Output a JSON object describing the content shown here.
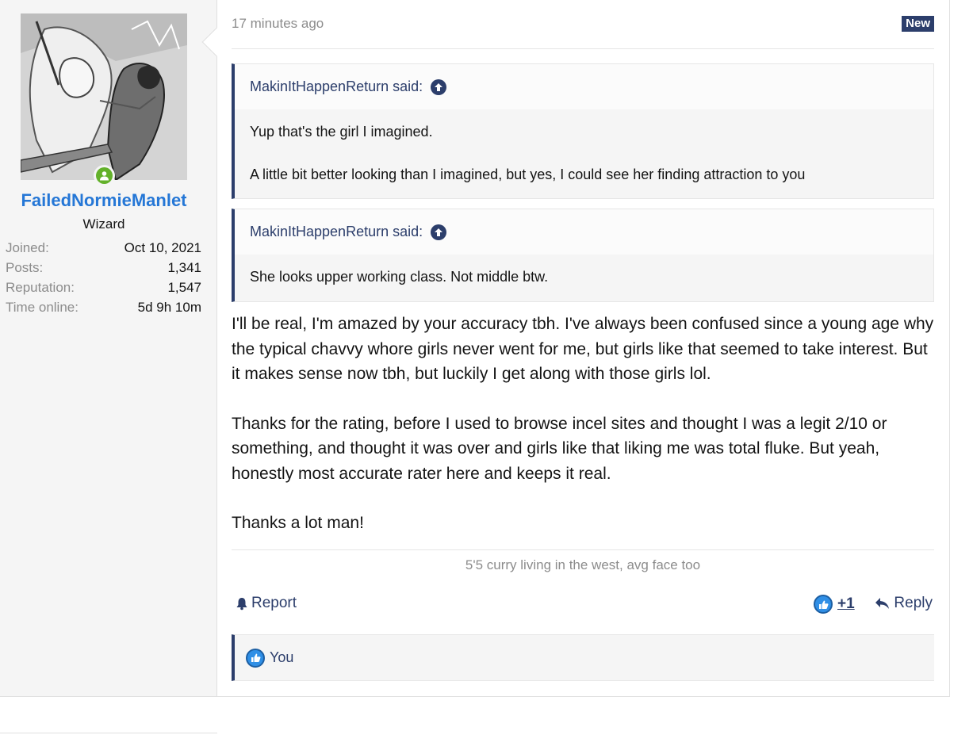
{
  "user": {
    "name": "FailedNormieManlet",
    "title": "Wizard",
    "stats": [
      {
        "label": "Joined:",
        "value": "Oct 10, 2021"
      },
      {
        "label": "Posts:",
        "value": "1,341"
      },
      {
        "label": "Reputation:",
        "value": "1,547"
      },
      {
        "label": "Time online:",
        "value": "5d 9h 10m"
      }
    ],
    "status_color": "#63b12a"
  },
  "post": {
    "time": "17 minutes ago",
    "badge": "New",
    "quotes": [
      {
        "author": "MakinItHappenReturn said:",
        "lines": [
          "Yup that's the girl I imagined.",
          "A little bit better looking than I imagined, but yes, I could see her finding attraction to you"
        ]
      },
      {
        "author": "MakinItHappenReturn said:",
        "lines": [
          "She looks upper working class. Not middle btw."
        ]
      }
    ],
    "paragraphs": [
      "I'll be real, I'm amazed by your accuracy tbh. I've always been confused since a young age why the typical chavvy whore girls never went for me, but girls like that seemed to take interest. But it makes sense now tbh, but luckily I get along with those girls lol.",
      "Thanks for the rating, before I used to browse incel sites and thought I was a legit 2/10 or something, and thought it was over and girls like that liking me was total fluke. But yeah, honestly most accurate rater here and keeps it real.",
      "Thanks a lot man!"
    ],
    "signature": "5'5 curry living in the west, avg face too"
  },
  "actions": {
    "report": "Report",
    "reaction_count": "+1",
    "reply": "Reply"
  },
  "reactions": {
    "users": "You"
  },
  "icons": {
    "report": "bell-icon",
    "like": "thumbs-up-icon",
    "reply": "reply-arrow-icon",
    "quote_jump": "arrow-up-circle-icon"
  },
  "colors": {
    "username": "#2577d6",
    "accent": "#2c3e6b",
    "like": "#2f8fe6"
  }
}
